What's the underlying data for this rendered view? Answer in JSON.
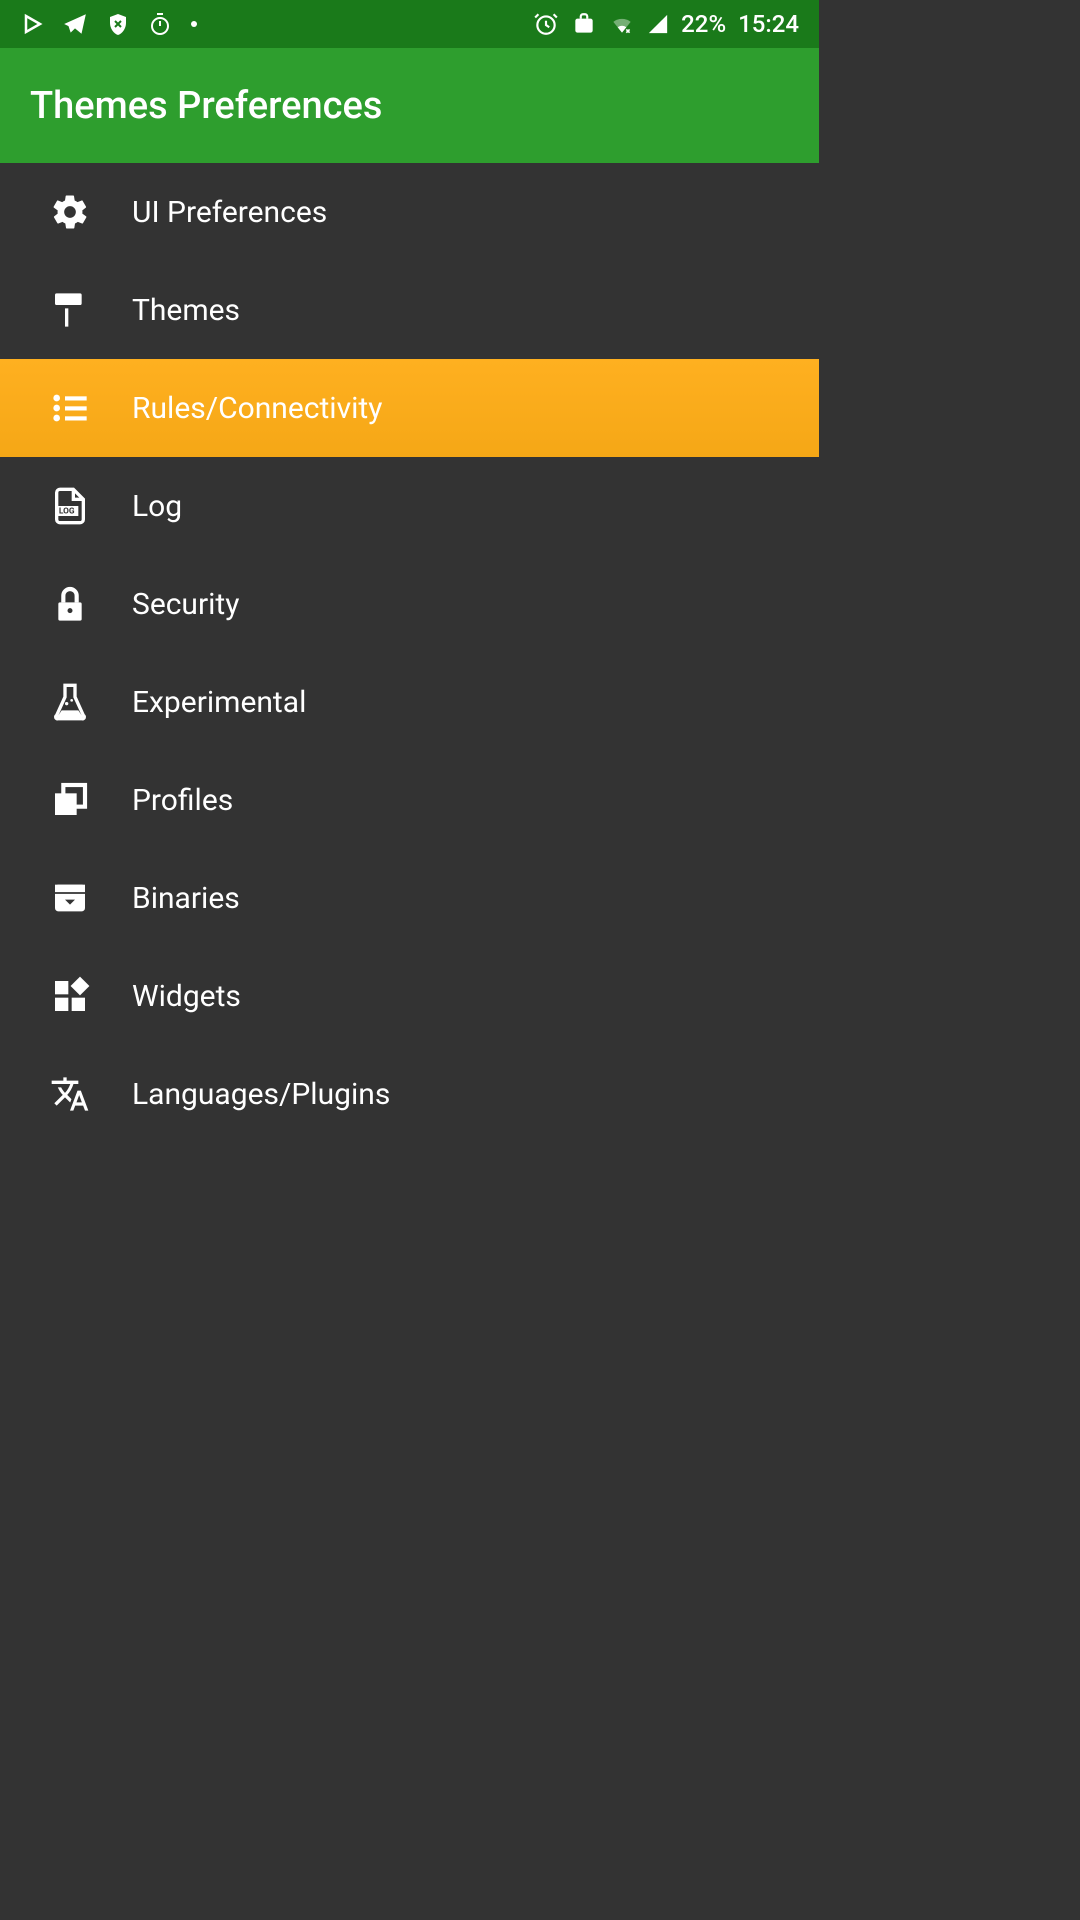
{
  "status_bar": {
    "battery_percent": "22%",
    "time": "15:24"
  },
  "app_bar": {
    "title": "Themes Preferences"
  },
  "menu": {
    "items": [
      {
        "label": "UI Preferences",
        "icon": "gear",
        "selected": false
      },
      {
        "label": "Themes",
        "icon": "paint-roller",
        "selected": false
      },
      {
        "label": "Rules/Connectivity",
        "icon": "list",
        "selected": true
      },
      {
        "label": "Log",
        "icon": "log-file",
        "selected": false
      },
      {
        "label": "Security",
        "icon": "lock",
        "selected": false
      },
      {
        "label": "Experimental",
        "icon": "flask",
        "selected": false
      },
      {
        "label": "Profiles",
        "icon": "profiles",
        "selected": false
      },
      {
        "label": "Binaries",
        "icon": "archive",
        "selected": false
      },
      {
        "label": "Widgets",
        "icon": "widgets",
        "selected": false
      },
      {
        "label": "Languages/Plugins",
        "icon": "translate",
        "selected": false
      }
    ]
  }
}
